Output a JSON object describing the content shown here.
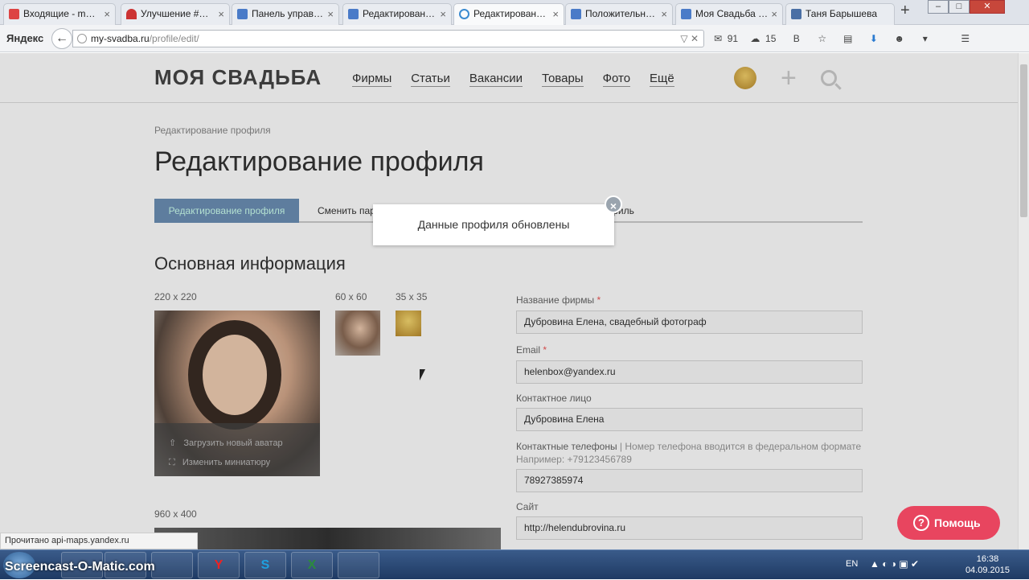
{
  "browser": {
    "tabs": [
      {
        "label": "Входящие - m…",
        "color": "#d44"
      },
      {
        "label": "Улучшение #…",
        "color": "#c33"
      },
      {
        "label": "Панель управ…",
        "color": "#4a7bc8"
      },
      {
        "label": "Редактирован…",
        "color": "#4a7bc8"
      },
      {
        "label": "Редактирован…",
        "color": "#3a8ad0"
      },
      {
        "label": "Положительн…",
        "color": "#4a7bc8"
      },
      {
        "label": "Моя Свадьба …",
        "color": "#4a7bc8"
      },
      {
        "label": "Таня Барышева",
        "color": "#4a6fa5"
      }
    ],
    "new_tab": "+",
    "win_buttons": [
      "–",
      "□",
      "✕"
    ],
    "yandex_logo": "Яндекс",
    "back_label": "←",
    "url_host": "my-svadba.ru",
    "url_path": "/profile/edit/",
    "url_tools": "▽ ✕",
    "mail_count": "91",
    "cloud_count": "15",
    "toolbar_icons": [
      "B",
      "☆",
      "▤",
      "⬇",
      "☻",
      "▾",
      "☰"
    ]
  },
  "site": {
    "logo": "МОЯ СВАДЬБА",
    "menu": [
      "Фирмы",
      "Статьи",
      "Вакансии",
      "Товары",
      "Фото",
      "Ещё"
    ],
    "plus": "+",
    "breadcrumb": "Редактирование профиля",
    "title": "Редактирование профиля",
    "tabs": [
      "Редактирование профиля",
      "Сменить пар",
      "филь"
    ],
    "section": "Основная информация",
    "sizes": [
      "220 x 220",
      "60 x 60",
      "35 x 35"
    ],
    "avatar_actions": [
      "Загрузить новый аватар",
      "Изменить миниатюру"
    ],
    "cover_size": "960 x 400"
  },
  "form": {
    "company_label": "Название фирмы",
    "company_value": "Дубровина Елена, свадебный фотограф",
    "email_label": "Email",
    "email_value": "helenbox@yandex.ru",
    "contact_label": "Контактное лицо",
    "contact_value": "Дубровина Елена",
    "phones_label": "Контактные телефоны",
    "phones_hint": "| Номер телефона вводится в федеральном формате",
    "phones_example": "Например: +79123456789",
    "phone_value": "78927385974",
    "site_label": "Сайт",
    "site_value": "http://helendubrovina.ru",
    "required_mark": "*"
  },
  "toast": {
    "message": "Данные профиля обновлены",
    "close": "×"
  },
  "help_button": {
    "label": "Помощь",
    "icon": "?"
  },
  "status_text": "Прочитано api-maps.yandex.ru",
  "taskbar": {
    "watermark": "Screencast-O-Matic.com",
    "items": [
      "",
      "",
      "",
      "Y",
      "S",
      "X",
      ""
    ],
    "lang": "EN",
    "tray": "▲ ◐ ◑ ▣ ✔",
    "time": "16:38",
    "date": "04.09.2015"
  }
}
